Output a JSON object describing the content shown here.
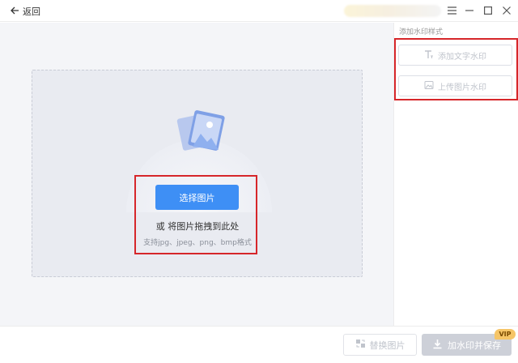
{
  "titlebar": {
    "back_label": "返回",
    "icons": {
      "back": "arrow-left-icon",
      "menu": "hamburger-menu-icon",
      "minimize": "minimize-icon",
      "maximize": "maximize-icon",
      "close": "close-icon"
    }
  },
  "upload": {
    "select_button": "选择图片",
    "drag_text": "或 将图片拖拽到此处",
    "formats_hint": "支持jpg、jpeg、png、bmp格式",
    "illustration": "picture-icon"
  },
  "watermark_panel": {
    "title": "添加水印样式",
    "add_text_watermark": "添加文字水印",
    "upload_image_watermark": "上传图片水印",
    "icons": {
      "text": "text-watermark-icon",
      "image": "image-watermark-icon"
    }
  },
  "bottom": {
    "replace_image": "替换图片",
    "save_with_watermark": "加水印并保存",
    "vip_badge": "VIP",
    "icons": {
      "replace": "replace-image-icon",
      "save": "download-icon"
    }
  },
  "colors": {
    "primary": "#3e8ff5",
    "highlight_box": "#d6262a",
    "disabled_button": "#cdd0d8",
    "vip_badge": "#f6c567"
  }
}
